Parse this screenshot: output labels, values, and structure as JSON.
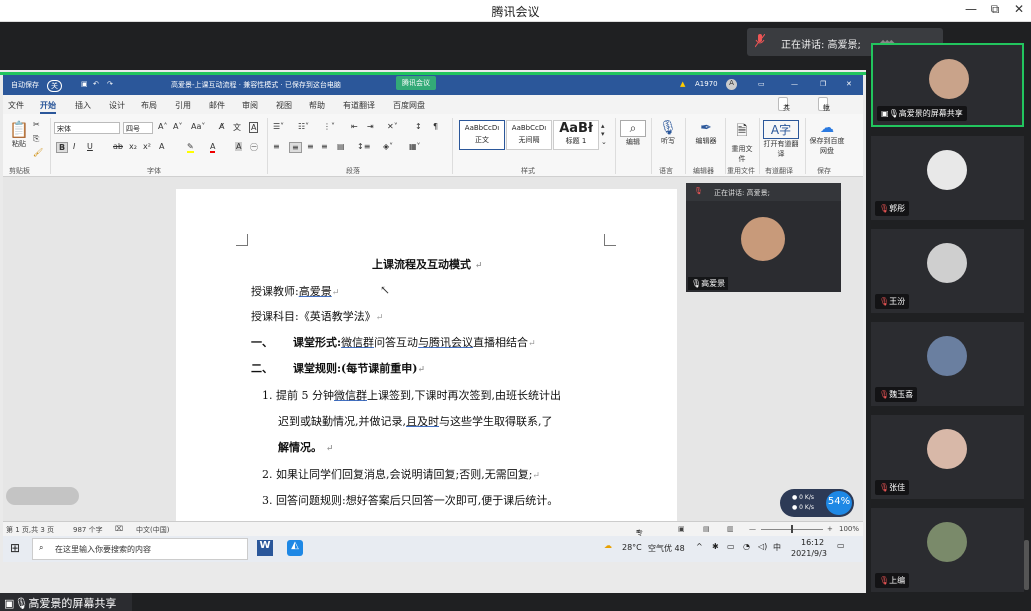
{
  "app": {
    "title": "腾讯会议"
  },
  "speaking": {
    "label": "正在讲话: 高爱景;"
  },
  "word": {
    "autosave": "自动保存",
    "toggle": "关",
    "doc_title": "高爱景-上课互动流程 · 兼容性模式 · 已保存到这台电脑",
    "overlay": "腾讯会议",
    "user": "A1970",
    "tabs": [
      "文件",
      "开始",
      "插入",
      "设计",
      "布局",
      "引用",
      "邮件",
      "审阅",
      "视图",
      "帮助",
      "有道翻译",
      "百度网盘"
    ],
    "share_btn": "共享",
    "comment_btn": "批注",
    "font_name": "宋体",
    "font_size": "四号",
    "styles": [
      "AaBbCcDı",
      "AaBbCcDı",
      "AaBł"
    ],
    "style_names": [
      "正文",
      "无间隔",
      "标题 1"
    ],
    "groups": [
      "剪贴板",
      "字体",
      "段落",
      "样式",
      "语言",
      "编辑器",
      "重用文件",
      "有道翻译",
      "保存"
    ],
    "paste": "粘贴",
    "edit": "编辑",
    "listen": "听写",
    "editor": "编辑器",
    "reuse": "重用文件",
    "open_translate": "打开有道翻译",
    "save_baidu": "保存到百度网盘"
  },
  "doc": {
    "title": "上课流程及互动模式",
    "teacher_label": "授课教师:",
    "teacher": "高爱景",
    "subject": "授课科目:《英语教学法》",
    "s1_num": "一、",
    "s1_label": "课堂形式:",
    "s1_a": "微信群",
    "s1_b": "问答互动",
    "s1_c": "与腾讯会议",
    "s1_d": "直播相结合",
    "s2_num": "二、",
    "s2_label": "课堂规则:(每节课前重申)",
    "r1_num": "1.",
    "r1_a": "提前 5 分钟",
    "r1_b": "微信群",
    "r1_c": "上课签到,下课时再次签到,由班长统计出",
    "r1_line2a": "迟到或缺勤情况,并做记录,",
    "r1_line2b": "且及时",
    "r1_line2c": "与这些学生取得联系,了",
    "r1_line3": "解情况。",
    "r2_num": "2.",
    "r2": "如果让同学们回复消息,会说明请回复;否则,无需回复;",
    "r3_num": "3.",
    "r3": "回答问题规则:想好答案后只回答一次即可,便于课后统计。"
  },
  "pip": {
    "label": "正在讲话: 高爱景;",
    "name": "高爱景"
  },
  "status": {
    "page": "第 1 页,共 3 页",
    "words": "987 个字",
    "lang": "中文(中国)",
    "focus": "专注",
    "zoom": "100%"
  },
  "taskbar": {
    "search": "在这里输入你要搜索的内容",
    "temp": "28°C",
    "air": "空气优 48",
    "ime": "中",
    "time": "16:12",
    "date": "2021/9/3"
  },
  "net": {
    "up": "0 K/s",
    "down": "0 K/s",
    "percent": "54%"
  },
  "share_label": "高爱景的屏幕共享",
  "participants": [
    {
      "name": "高爱景的屏幕共享",
      "color": "#c9a38a"
    },
    {
      "name": "郭彤",
      "color": "#e8e8e8"
    },
    {
      "name": "王汾",
      "color": "#cfcfcf"
    },
    {
      "name": "魏玉喜",
      "color": "#6a7fa0"
    },
    {
      "name": "张佳",
      "color": "#d8b8a8"
    },
    {
      "name": "上编",
      "color": "#7a8a6a"
    }
  ]
}
